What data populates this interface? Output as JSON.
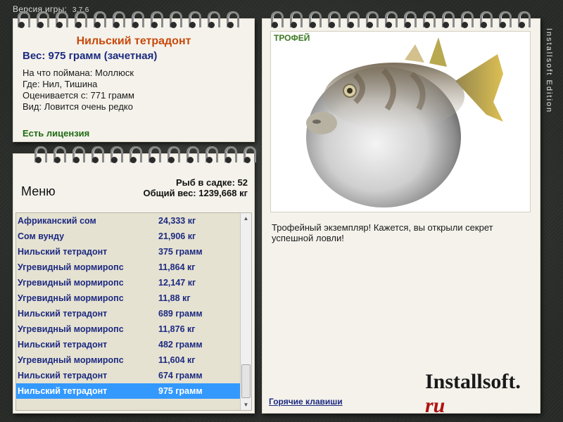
{
  "version": {
    "label": "Версия игры:",
    "number": "3.7.6"
  },
  "catch": {
    "title": "Нильский тетрадонт",
    "weight": "Вес: 975 грамм (зачетная)",
    "bait": "На что поймана: Моллюск",
    "location": "Где: Нил, Тишина",
    "min_weight": "Оценивается с: 771 грамм",
    "rarity": "Вид: Ловится очень редко",
    "license": "Есть лицензия"
  },
  "menu": {
    "label": "Меню",
    "fish_count": "Рыб в садке: 52",
    "total_weight": "Общий вес: 1239,668 кг"
  },
  "list": [
    {
      "name": "Африканский сом",
      "weight": "24,333 кг"
    },
    {
      "name": "Сом вунду",
      "weight": "21,906 кг"
    },
    {
      "name": "Нильский тетрадонт",
      "weight": "375 грамм"
    },
    {
      "name": "Угревидный мормиропс",
      "weight": "11,864 кг"
    },
    {
      "name": "Угревидный мормиропс",
      "weight": "12,147 кг"
    },
    {
      "name": "Угревидный мормиропс",
      "weight": "11,88 кг"
    },
    {
      "name": "Нильский тетрадонт",
      "weight": "689 грамм"
    },
    {
      "name": "Угревидный мормиропс",
      "weight": "11,876 кг"
    },
    {
      "name": "Нильский тетрадонт",
      "weight": "482 грамм"
    },
    {
      "name": "Угревидный мормиропс",
      "weight": "11,604 кг"
    },
    {
      "name": "Нильский тетрадонт",
      "weight": "674 грамм"
    },
    {
      "name": "Нильский тетрадонт",
      "weight": "975 грамм",
      "selected": true
    }
  ],
  "trophy": {
    "tag": "ТРОФЕЙ",
    "description": "Трофейный экземпляр! Кажется, вы открыли секрет успешной ловли!",
    "hotkeys": "Горячие клавиши"
  },
  "branding": {
    "logo_main": "Installsoft.",
    "logo_ru": "ru",
    "edition": "Installsoft Edition"
  },
  "colors": {
    "paper": "#f4f2eb",
    "title_orange": "#c8480a",
    "text_blue": "#1c2a80",
    "license_green": "#1f6b12",
    "selection": "#3399ff"
  }
}
